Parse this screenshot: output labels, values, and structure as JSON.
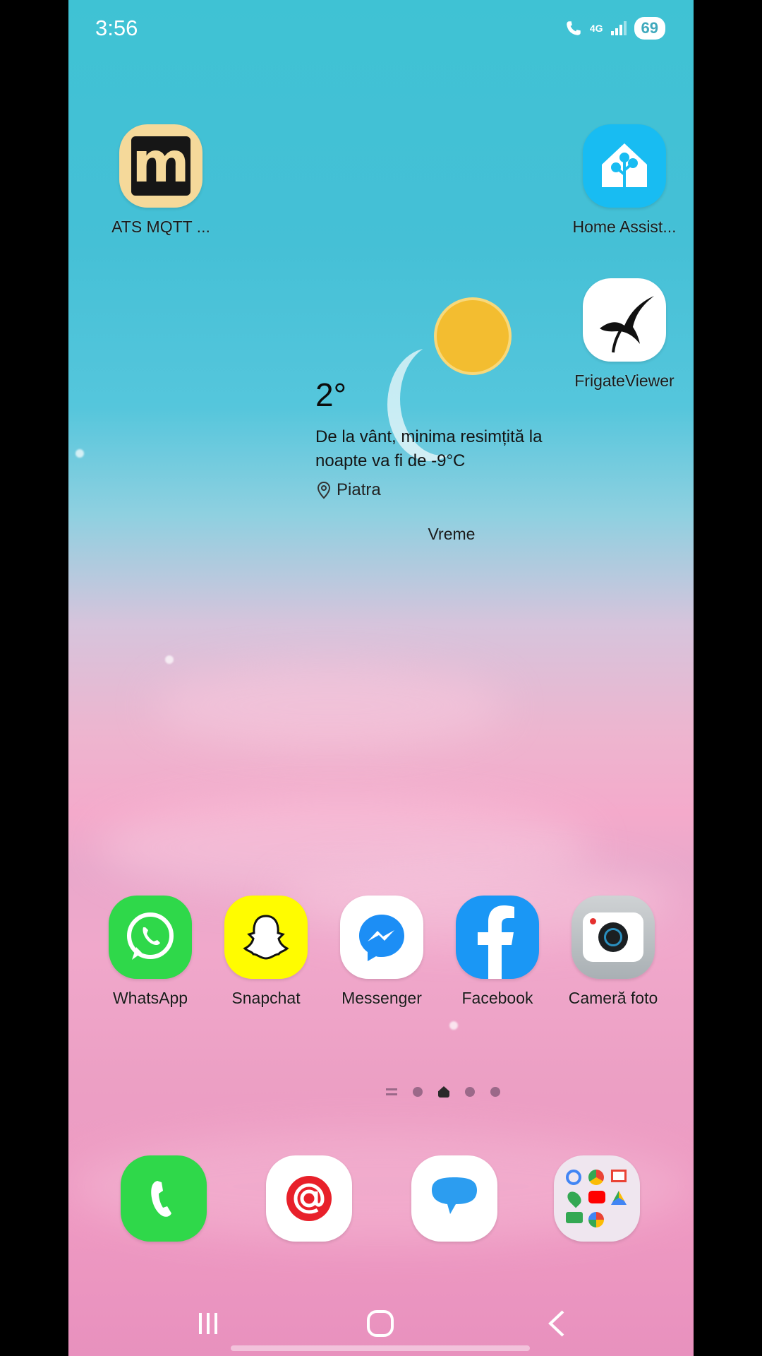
{
  "status_bar": {
    "time": "3:56",
    "network": "4G",
    "battery": "69"
  },
  "home_apps": [
    {
      "label": "ATS MQTT ..."
    },
    {
      "label": "Home Assist..."
    },
    {
      "label": "FrigateViewer"
    }
  ],
  "weather_widget": {
    "temperature": "2°",
    "description": "De la vânt, minima resimțită la noapte va fi de -9°C",
    "location": "Piatra",
    "title": "Vreme"
  },
  "favorites": [
    {
      "label": "WhatsApp"
    },
    {
      "label": "Snapchat"
    },
    {
      "label": "Messenger"
    },
    {
      "label": "Facebook"
    },
    {
      "label": "Cameră foto"
    }
  ],
  "page_indicator": {
    "pages": 4,
    "current": 2
  },
  "dock": [
    "phone-icon",
    "email-icon",
    "messages-icon",
    "google-folder-icon"
  ],
  "colors": {
    "whatsapp": "#25d366",
    "snapchat": "#fffc00",
    "facebook": "#1877f2",
    "home_assistant": "#18bcf2",
    "phone": "#2fd84a"
  }
}
